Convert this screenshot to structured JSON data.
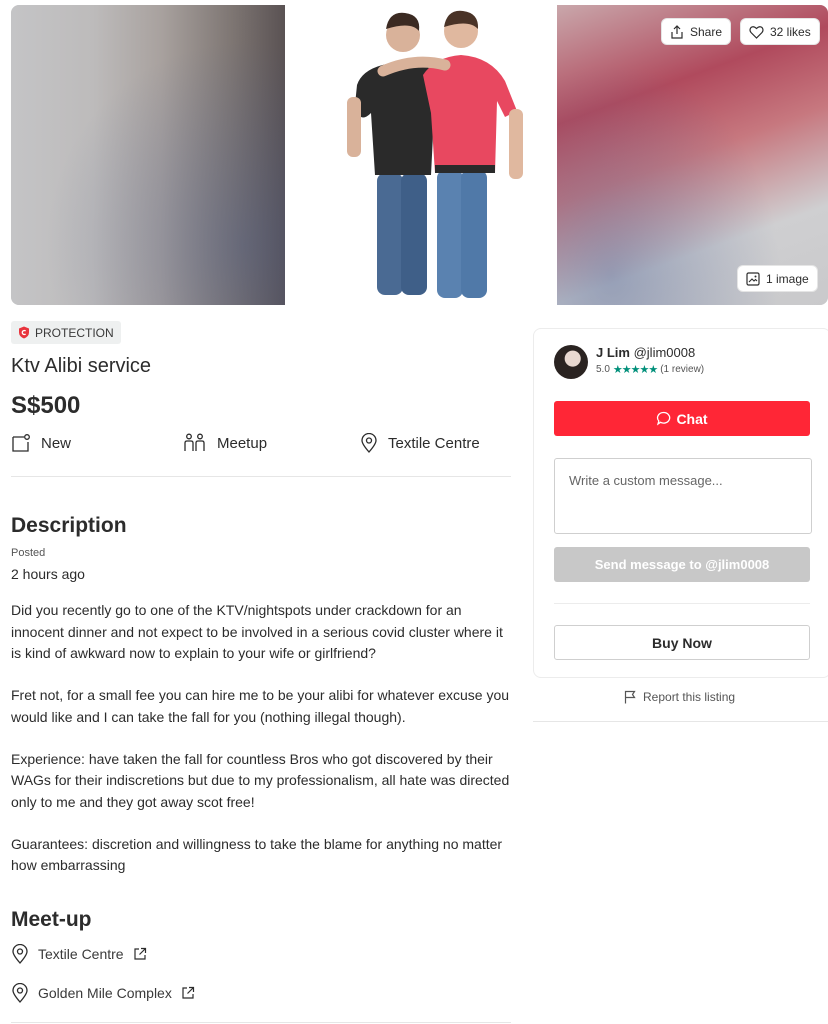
{
  "hero": {
    "share_label": "Share",
    "likes_label": "32 likes",
    "image_count_label": "1 image"
  },
  "listing": {
    "badge": "PROTECTION",
    "title": "Ktv Alibi service",
    "price": "S$500",
    "condition": "New",
    "deal_method": "Meetup",
    "location": "Textile Centre"
  },
  "description": {
    "heading": "Description",
    "posted_label": "Posted",
    "posted_time": "2 hours ago",
    "paragraphs": [
      "Did you recently go to one of the KTV/nightspots under crackdown for an innocent dinner and not expect to be involved in a serious covid cluster where it is kind of awkward now to explain to your wife or girlfriend?",
      "Fret not, for a small fee you can hire me to be your alibi for whatever excuse you would like and I can take the fall for you (nothing illegal though).",
      "Experience: have taken the fall for countless Bros who got discovered by their WAGs for their indiscretions but due to my professionalism, all hate was directed only to me and they got away scot free!",
      "Guarantees: discretion and willingness to take the blame for anything no matter how embarrassing"
    ]
  },
  "meetup": {
    "heading": "Meet-up",
    "locations": [
      "Textile Centre",
      "Golden Mile Complex"
    ]
  },
  "seller": {
    "name": "J Lim",
    "handle": "@jlim0008",
    "rating": "5.0",
    "stars": "★★★★★",
    "reviews": "(1 review)"
  },
  "actions": {
    "chat_label": "Chat",
    "message_placeholder": "Write a custom message...",
    "send_label": "Send message to @jlim0008",
    "buy_label": "Buy Now",
    "report_label": "Report this listing"
  },
  "colors": {
    "accent_red": "#ff2636",
    "star_green": "#008f7a",
    "disabled_gray": "#c8c8c8"
  }
}
